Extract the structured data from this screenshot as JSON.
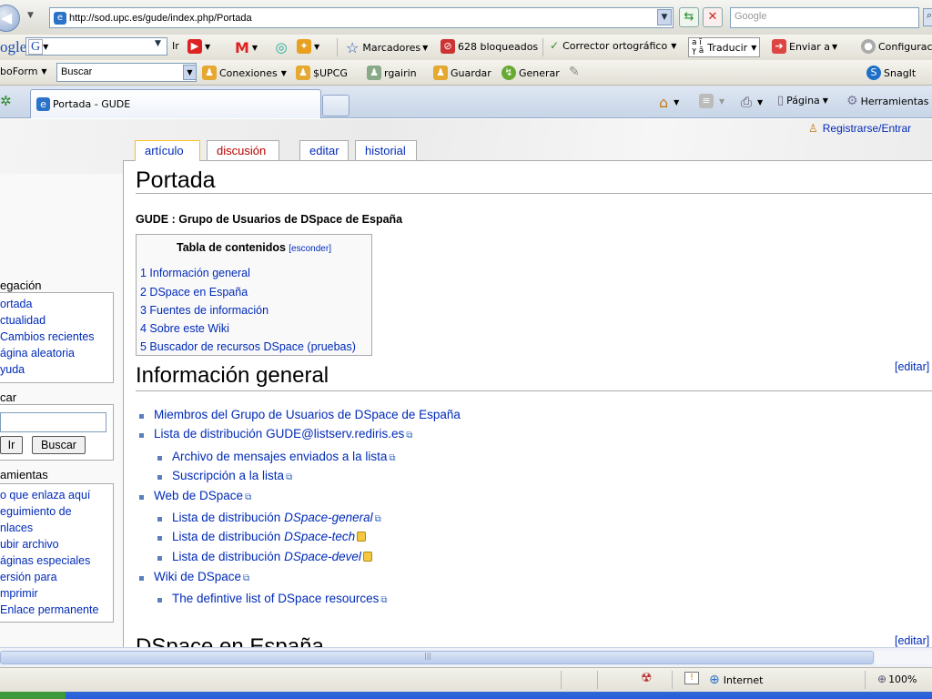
{
  "browser": {
    "url": "http://sod.upc.es/gude/index.php/Portada",
    "search_placeholder": "Google",
    "google_label": "ogle",
    "google_ir": "Ir",
    "roboform_label": "boForm",
    "roboform_search": "Buscar",
    "toolbar1": {
      "marcadores": "Marcadores",
      "bloqueados": "628 bloqueados",
      "corrector": "Corrector ortográfico",
      "traducir": "Traducir",
      "enviar": "Enviar a",
      "configurar": "Configurac"
    },
    "toolbar2": {
      "conexiones": "Conexiones",
      "upcg": "$UPCG",
      "rgairin": "rgairin",
      "guardar": "Guardar",
      "generar": "Generar",
      "snagit": "SnagIt"
    },
    "tab_title": "Portada - GUDE",
    "cmd": {
      "pagina": "Página",
      "herramientas": "Herramientas"
    }
  },
  "wiki": {
    "user_link": "Registrarse/Entrar",
    "tabs": {
      "articulo": "artículo",
      "discusion": "discusión",
      "editar": "editar",
      "historial": "historial"
    },
    "page_title": "Portada",
    "subtitle": "GUDE : Grupo de Usuarios de DSpace de España",
    "toc": {
      "title": "Tabla de contenidos",
      "toggle": "[esconder]",
      "items": [
        "1 Información general",
        "2 DSpace en España",
        "3 Fuentes de información",
        "4 Sobre este Wiki",
        "5 Buscador de recursos DSpace (pruebas)"
      ]
    },
    "section1": {
      "title": "Información general",
      "edit": "[editar]",
      "items": [
        "Miembros del Grupo de Usuarios de DSpace de España",
        "Lista de distribución GUDE@listserv.rediris.es",
        "Archivo de mensajes enviados a la lista",
        "Suscripción a la lista",
        "Web de DSpace",
        "Lista de distribución ",
        "DSpace-general",
        "Lista de distribución ",
        "DSpace-tech",
        "Lista de distribución ",
        "DSpace-devel",
        "Wiki de DSpace",
        "The defintive list of DSpace resources"
      ]
    },
    "section2": {
      "title": "DSpace en España",
      "edit": "[editar]"
    },
    "sidebar": {
      "nav_title": "egación",
      "nav": [
        "ortada",
        "ctualidad",
        "Cambios recientes",
        "ágina aleatoria",
        "yuda"
      ],
      "search_title": "car",
      "search_go": "Ir",
      "search_btn": "Buscar",
      "tools_title": "amientas",
      "tools": [
        "o que enlaza aquí",
        "eguimiento de",
        "nlaces",
        "ubir archivo",
        "áginas especiales",
        "ersión para",
        "mprimir",
        "Enlace permanente"
      ]
    }
  },
  "status": {
    "zone": "Internet",
    "zoom": "100%"
  }
}
